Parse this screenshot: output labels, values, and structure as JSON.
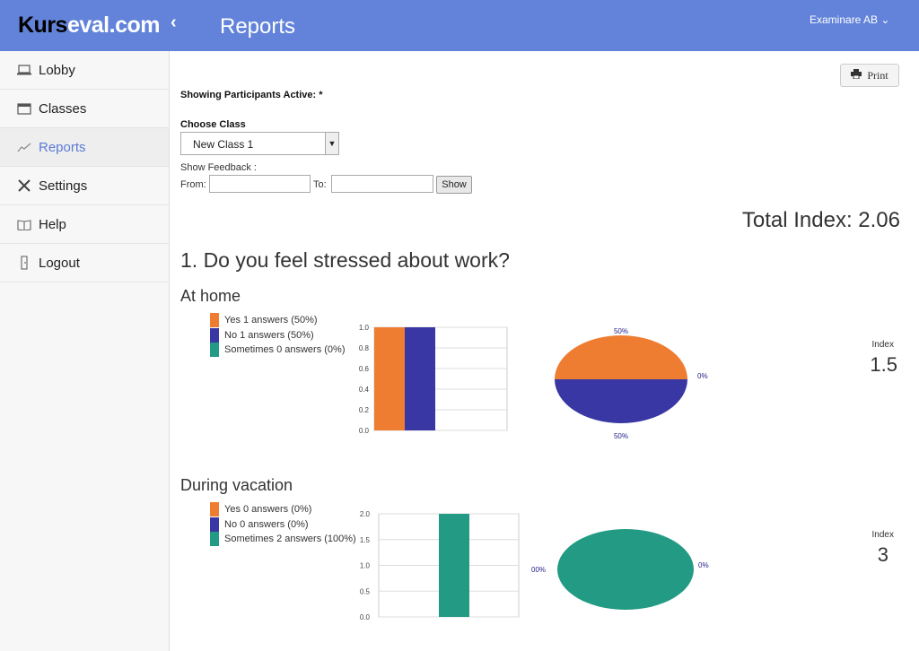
{
  "header": {
    "brand_part1": "Kurs",
    "brand_part2": "eval.com",
    "back_icon": "chevron-left-icon",
    "title": "Reports",
    "account": "Examinare AB ⌄"
  },
  "sidebar": {
    "items": [
      {
        "label": "Lobby",
        "icon": "laptop-icon"
      },
      {
        "label": "Classes",
        "icon": "window-icon"
      },
      {
        "label": "Reports",
        "icon": "chart-icon",
        "active": true
      },
      {
        "label": "Settings",
        "icon": "tools-icon"
      },
      {
        "label": "Help",
        "icon": "book-icon"
      },
      {
        "label": "Logout",
        "icon": "door-icon"
      }
    ]
  },
  "toolbar": {
    "print_label": "Print"
  },
  "filters": {
    "participants": "Showing Participants Active: *",
    "choose_class_label": "Choose Class",
    "class_value": "New Class 1",
    "show_feedback_label": "Show Feedback :",
    "from_label": "From:",
    "to_label": "To:",
    "show_button": "Show"
  },
  "total_index": "Total Index: 2.06",
  "question": "1. Do you feel stressed about work?",
  "colors": {
    "yes": "#ef7d31",
    "no": "#3837a3",
    "sometimes": "#229a84",
    "header": "#6283d9",
    "accent": "#5b7bd6"
  },
  "sections": [
    {
      "title": "At home",
      "legend": [
        "Yes 1 answers (50%)",
        "No 1 answers (50%)",
        "Sometimes 0 answers (0%)"
      ],
      "index_label": "Index",
      "index_value": "1.5",
      "pie_labels": [
        "50%",
        "50%",
        "0%"
      ]
    },
    {
      "title": "During vacation",
      "legend": [
        "Yes 0 answers (0%)",
        "No 0 answers (0%)",
        "Sometimes 2 answers (100%)"
      ],
      "index_label": "Index",
      "index_value": "3",
      "pie_labels": [
        "00%",
        "0%"
      ]
    }
  ],
  "chart_data": [
    {
      "type": "bar",
      "categories": [
        "Yes",
        "No",
        "Sometimes"
      ],
      "values": [
        1,
        1,
        0
      ],
      "ylim": [
        0,
        1.0
      ],
      "yticks": [
        "1.0",
        "0.8",
        "0.6",
        "0.4",
        "0.2",
        "0.0"
      ],
      "grid": true
    },
    {
      "type": "pie",
      "categories": [
        "Yes",
        "No",
        "Sometimes"
      ],
      "values": [
        50,
        50,
        0
      ]
    },
    {
      "type": "bar",
      "categories": [
        "Yes",
        "No",
        "Sometimes"
      ],
      "values": [
        0,
        0,
        2
      ],
      "ylim": [
        0,
        2.0
      ],
      "yticks": [
        "2.0",
        "1.5",
        "1.0",
        "0.5",
        "0.0"
      ],
      "grid": true
    },
    {
      "type": "pie",
      "categories": [
        "Yes",
        "No",
        "Sometimes"
      ],
      "values": [
        0,
        0,
        100
      ]
    }
  ]
}
